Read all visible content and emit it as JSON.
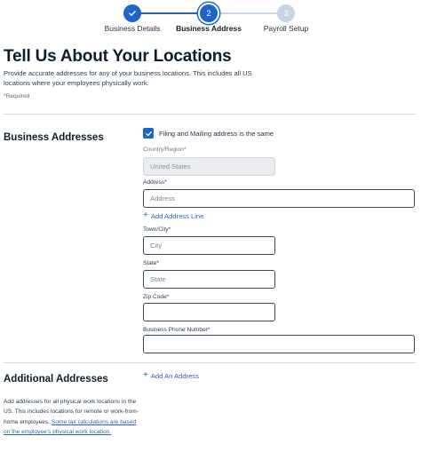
{
  "stepper": {
    "steps": [
      {
        "label": "Business Details",
        "state": "done",
        "marker": "✓"
      },
      {
        "label": "Business Address",
        "state": "current",
        "marker": "2"
      },
      {
        "label": "Payroll Setup",
        "state": "pending",
        "marker": "3"
      }
    ]
  },
  "header": {
    "title": "Tell Us About Your Locations",
    "description": "Provide accurate addresses for any of your business locations. This includes all US locations where your employees physically work.",
    "required_note": "*Required"
  },
  "business_addresses": {
    "title": "Business Addresses",
    "same_address_checkbox": {
      "label": "Filing and Mailing address is the same",
      "checked": true
    },
    "country": {
      "label": "Country/Region*",
      "value": "United States"
    },
    "address": {
      "label": "Address*",
      "placeholder": "Address"
    },
    "add_address_line": "Add Address Line",
    "city": {
      "label": "Town/City*",
      "placeholder": "City"
    },
    "state": {
      "label": "State*",
      "placeholder": "State"
    },
    "zip": {
      "label": "Zip Code*",
      "placeholder": ""
    },
    "phone": {
      "label": "Business Phone Number*",
      "placeholder": ""
    }
  },
  "additional_addresses": {
    "title": "Additional Addresses",
    "add_link": "Add An Address",
    "info_text": "Add addresses for all physical work locations in the US. This includes locations for remote or work-from-home employees.",
    "info_link": "Some tax calculations are based on the employee's physical work location."
  },
  "colors": {
    "accent": "#1d66c9",
    "link": "#2b63b8",
    "pending": "#c8d4e6"
  }
}
